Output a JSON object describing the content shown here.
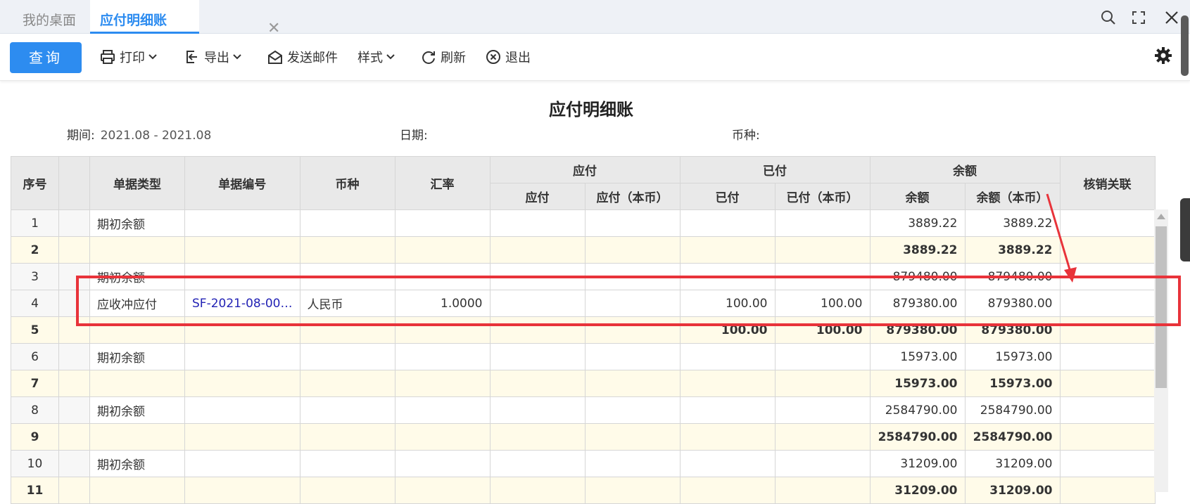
{
  "tabs": {
    "home": "我的桌面",
    "active": "应付明细账",
    "close": "✕"
  },
  "toolbar": {
    "query": "查询",
    "print": "打印",
    "export": "导出",
    "send_mail": "发送邮件",
    "style": "样式",
    "refresh": "刷新",
    "exit": "退出"
  },
  "report": {
    "title": "应付明细账",
    "period_label": "期间:",
    "period_value": "2021.08 - 2021.08",
    "date_label": "日期:",
    "currency_label": "币种:"
  },
  "table": {
    "headers": {
      "seq": "序号",
      "doc_type": "单据类型",
      "doc_no": "单据编号",
      "currency": "币种",
      "rate": "汇率",
      "payable_group": "应付",
      "payable": "应付",
      "payable_base": "应付（本币）",
      "paid_group": "已付",
      "paid": "已付",
      "paid_base": "已付（本币）",
      "balance_group": "余额",
      "balance": "余额",
      "balance_base": "余额（本币）",
      "writeoff": "核销关联"
    },
    "rows": [
      {
        "seq": "1",
        "type": "期初余额",
        "no": "",
        "cur": "",
        "rate": "",
        "pay": "",
        "pay_b": "",
        "paid": "",
        "paid_b": "",
        "bal": "3889.22",
        "bal_b": "3889.22",
        "sub": false
      },
      {
        "seq": "2",
        "type": "",
        "no": "",
        "cur": "",
        "rate": "",
        "pay": "",
        "pay_b": "",
        "paid": "",
        "paid_b": "",
        "bal": "3889.22",
        "bal_b": "3889.22",
        "sub": true
      },
      {
        "seq": "3",
        "type": "期初余额",
        "no": "",
        "cur": "",
        "rate": "",
        "pay": "",
        "pay_b": "",
        "paid": "",
        "paid_b": "",
        "bal": "879480.00",
        "bal_b": "879480.00",
        "sub": false
      },
      {
        "seq": "4",
        "type": "应收冲应付",
        "no": "SF-2021-08-00…",
        "cur": "人民币",
        "rate": "1.0000",
        "pay": "",
        "pay_b": "",
        "paid": "100.00",
        "paid_b": "100.00",
        "bal": "879380.00",
        "bal_b": "879380.00",
        "sub": false
      },
      {
        "seq": "5",
        "type": "",
        "no": "",
        "cur": "",
        "rate": "",
        "pay": "",
        "pay_b": "",
        "paid": "100.00",
        "paid_b": "100.00",
        "bal": "879380.00",
        "bal_b": "879380.00",
        "sub": true
      },
      {
        "seq": "6",
        "type": "期初余额",
        "no": "",
        "cur": "",
        "rate": "",
        "pay": "",
        "pay_b": "",
        "paid": "",
        "paid_b": "",
        "bal": "15973.00",
        "bal_b": "15973.00",
        "sub": false
      },
      {
        "seq": "7",
        "type": "",
        "no": "",
        "cur": "",
        "rate": "",
        "pay": "",
        "pay_b": "",
        "paid": "",
        "paid_b": "",
        "bal": "15973.00",
        "bal_b": "15973.00",
        "sub": true
      },
      {
        "seq": "8",
        "type": "期初余额",
        "no": "",
        "cur": "",
        "rate": "",
        "pay": "",
        "pay_b": "",
        "paid": "",
        "paid_b": "",
        "bal": "2584790.00",
        "bal_b": "2584790.00",
        "sub": false
      },
      {
        "seq": "9",
        "type": "",
        "no": "",
        "cur": "",
        "rate": "",
        "pay": "",
        "pay_b": "",
        "paid": "",
        "paid_b": "",
        "bal": "2584790.00",
        "bal_b": "2584790.00",
        "sub": true
      },
      {
        "seq": "10",
        "type": "期初余额",
        "no": "",
        "cur": "",
        "rate": "",
        "pay": "",
        "pay_b": "",
        "paid": "",
        "paid_b": "",
        "bal": "31209.00",
        "bal_b": "31209.00",
        "sub": false
      },
      {
        "seq": "11",
        "type": "",
        "no": "",
        "cur": "",
        "rate": "",
        "pay": "",
        "pay_b": "",
        "paid": "",
        "paid_b": "",
        "bal": "31209.00",
        "bal_b": "31209.00",
        "sub": true
      }
    ]
  },
  "colors": {
    "accent": "#2d8cf0",
    "highlight": "#e8333a",
    "subtotal_bg": "#fffbe9",
    "link": "#2323b5"
  },
  "icons": [
    "search-icon",
    "fullscreen-icon",
    "close-icon",
    "printer-icon",
    "chevron-down-icon",
    "export-icon",
    "mail-icon",
    "refresh-icon",
    "exit-icon",
    "gear-icon"
  ]
}
